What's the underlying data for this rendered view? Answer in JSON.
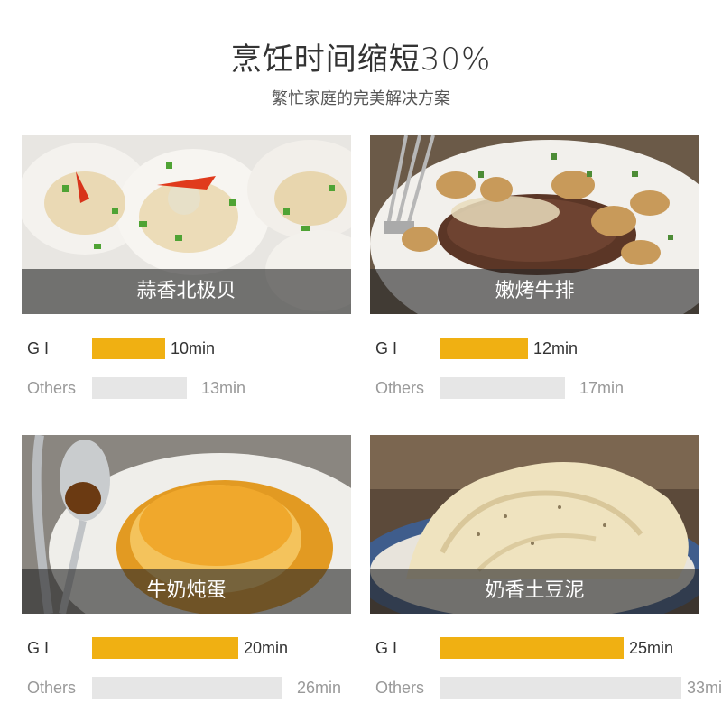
{
  "header": {
    "title": "烹饪时间缩短30%",
    "subtitle": "繁忙家庭的完美解决方案"
  },
  "dishes": [
    {
      "name": "蒜香北极贝",
      "gi_label": "G I",
      "gi_time": "10min",
      "gi_minutes": 10,
      "others_label": "Others",
      "others_time": "13min",
      "others_minutes": 13
    },
    {
      "name": "嫩烤牛排",
      "gi_label": "G I",
      "gi_time": "12min",
      "gi_minutes": 12,
      "others_label": "Others",
      "others_time": "17min",
      "others_minutes": 17
    },
    {
      "name": "牛奶炖蛋",
      "gi_label": "G I",
      "gi_time": "20min",
      "gi_minutes": 20,
      "others_label": "Others",
      "others_time": "26min",
      "others_minutes": 26
    },
    {
      "name": "奶香土豆泥",
      "gi_label": "G I",
      "gi_time": "25min",
      "gi_minutes": 25,
      "others_label": "Others",
      "others_time": "33min",
      "others_minutes": 33
    }
  ],
  "colors": {
    "gi_bar": "#f0b012",
    "others_bar": "#e6e6e6",
    "caption_bg": "rgba(40,40,40,0.62)"
  }
}
